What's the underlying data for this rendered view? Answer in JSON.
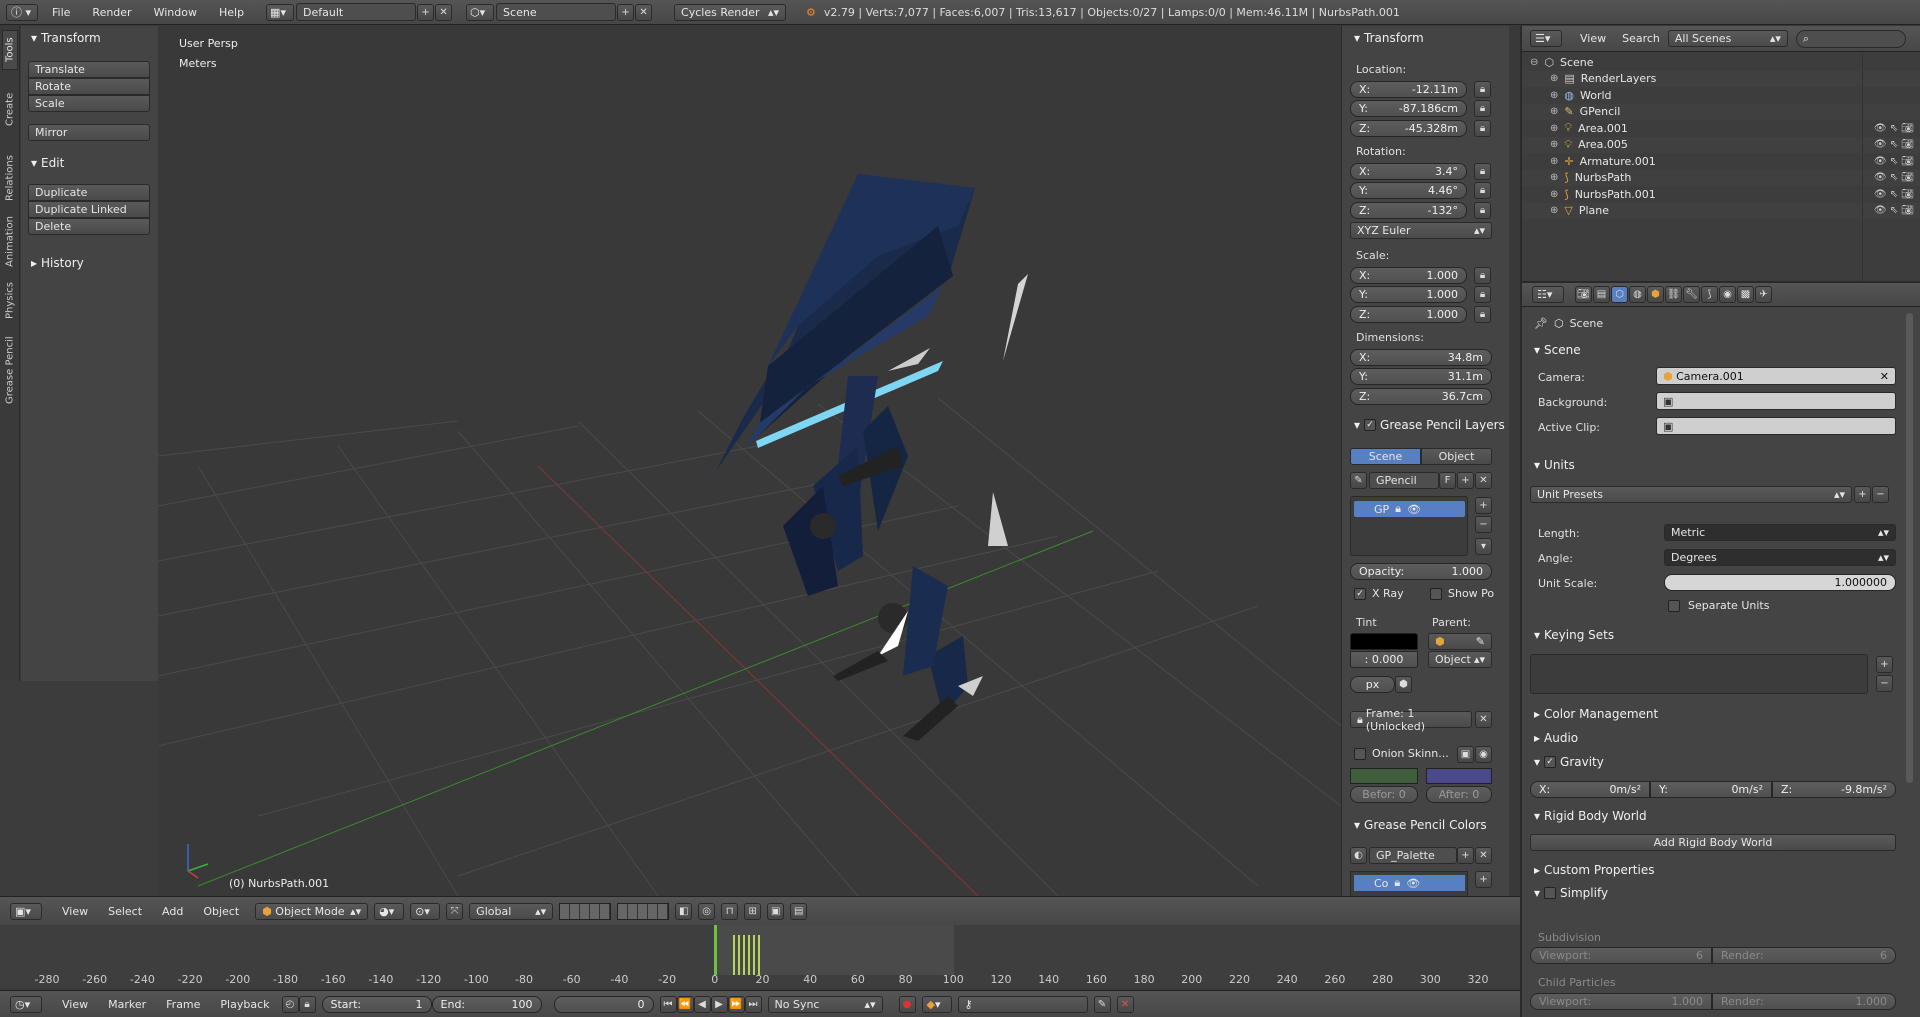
{
  "topbar": {
    "menus": [
      "File",
      "Render",
      "Window",
      "Help"
    ],
    "layout": "Default",
    "scene": "Scene",
    "engine": "Cycles Render",
    "stats": "v2.79 | Verts:7,077 | Faces:6,007 | Tris:13,617 | Objects:0/27 | Lamps:0/0 | Mem:46.11M | NurbsPath.001"
  },
  "tool_tabs": [
    "Tools",
    "Create",
    "Relations",
    "Animation",
    "Physics",
    "Grease Pencil"
  ],
  "tools": {
    "transform_title": "Transform",
    "transform_buttons": [
      "Translate",
      "Rotate",
      "Scale"
    ],
    "mirror": "Mirror",
    "edit_title": "Edit",
    "edit_buttons": [
      "Duplicate",
      "Duplicate Linked",
      "Delete"
    ],
    "history_title": "History"
  },
  "viewport": {
    "view_name": "User Persp",
    "units": "Meters",
    "object_info": "(0) NurbsPath.001"
  },
  "view_header": {
    "menus": [
      "View",
      "Select",
      "Add",
      "Object"
    ],
    "mode": "Object Mode",
    "orientation": "Global"
  },
  "properties_n": {
    "transform_title": "Transform",
    "location_label": "Location:",
    "location": [
      {
        "axis": "X:",
        "value": "-12.11m"
      },
      {
        "axis": "Y:",
        "value": "-87.186cm"
      },
      {
        "axis": "Z:",
        "value": "-45.328m"
      }
    ],
    "rotation_label": "Rotation:",
    "rotation": [
      {
        "axis": "X:",
        "value": "3.4°"
      },
      {
        "axis": "Y:",
        "value": "4.46°"
      },
      {
        "axis": "Z:",
        "value": "-132°"
      }
    ],
    "rotation_mode": "XYZ Euler",
    "scale_label": "Scale:",
    "scale": [
      {
        "axis": "X:",
        "value": "1.000"
      },
      {
        "axis": "Y:",
        "value": "1.000"
      },
      {
        "axis": "Z:",
        "value": "1.000"
      }
    ],
    "dimensions_label": "Dimensions:",
    "dimensions": [
      {
        "axis": "X:",
        "value": "34.8m"
      },
      {
        "axis": "Y:",
        "value": "31.1m"
      },
      {
        "axis": "Z:",
        "value": "36.7cm"
      }
    ],
    "gp_layers_title": "Grease Pencil Layers",
    "gp_scene_tab": "Scene",
    "gp_object_tab": "Object",
    "gp_name": "GPencil",
    "gp_f": "F",
    "gp_layer": "GP",
    "opacity": "Opacity:",
    "opacity_value": "1.000",
    "xray": "X Ray",
    "show_points": "Show Po",
    "tint": "Tint",
    "parent": "Parent:",
    "tint_value": ": 0.000",
    "parent_type": "Object",
    "px": "px",
    "frame": "Frame: 1 (Unlocked)",
    "onion": "Onion Skinn...",
    "before": "Befor: 0",
    "after": "After: 0",
    "gp_colors_title": "Grease Pencil Colors",
    "palette": "GP_Palette",
    "color_item": "Co"
  },
  "outliner": {
    "header_menus": [
      "View",
      "Search"
    ],
    "display": "All Scenes",
    "items": [
      {
        "name": "Scene",
        "indent": 0
      },
      {
        "name": "RenderLayers",
        "indent": 1
      },
      {
        "name": "World",
        "indent": 1
      },
      {
        "name": "GPencil",
        "indent": 1
      },
      {
        "name": "Area.001",
        "indent": 1
      },
      {
        "name": "Area.005",
        "indent": 1
      },
      {
        "name": "Armature.001",
        "indent": 1
      },
      {
        "name": "NurbsPath",
        "indent": 1
      },
      {
        "name": "NurbsPath.001",
        "indent": 1
      },
      {
        "name": "Plane",
        "indent": 1
      }
    ]
  },
  "scene_props": {
    "breadcrumb": "Scene",
    "scene_title": "Scene",
    "camera_label": "Camera:",
    "camera_value": "Camera.001",
    "background_label": "Background:",
    "active_clip_label": "Active Clip:",
    "units_title": "Units",
    "unit_presets": "Unit Presets",
    "length_label": "Length:",
    "length_value": "Metric",
    "angle_label": "Angle:",
    "angle_value": "Degrees",
    "unit_scale_label": "Unit Scale:",
    "unit_scale_value": "1.000000",
    "separate_units": "Separate Units",
    "keying_sets_title": "Keying Sets",
    "color_management": "Color Management",
    "audio": "Audio",
    "gravity": "Gravity",
    "gravity_values": [
      {
        "axis": "X:",
        "value": "0m/s²"
      },
      {
        "axis": "Y:",
        "value": "0m/s²"
      },
      {
        "axis": "Z:",
        "value": "-9.8m/s²"
      }
    ],
    "rigid_body_world": "Rigid Body World",
    "add_rigid_body_world": "Add Rigid Body World",
    "custom_properties": "Custom Properties",
    "simplify": "Simplify",
    "subdivision": "Subdivision",
    "viewport_label": "Viewport:",
    "render_label": "Render:",
    "sub_viewport": "6",
    "sub_render": "6",
    "child_particles": "Child Particles",
    "cp_viewport": "1.000",
    "cp_render": "1.000"
  },
  "timeline": {
    "ticks": [
      "-280",
      "-260",
      "-240",
      "-220",
      "-200",
      "-180",
      "-160",
      "-140",
      "-120",
      "-100",
      "-80",
      "-60",
      "-40",
      "-20",
      "0",
      "20",
      "40",
      "60",
      "80",
      "100",
      "120",
      "140",
      "160",
      "180",
      "200",
      "220",
      "240",
      "260",
      "280",
      "300",
      "320"
    ],
    "menus": [
      "View",
      "Marker",
      "Frame",
      "Playback"
    ],
    "start_label": "Start:",
    "start": "1",
    "end_label": "End:",
    "end": "100",
    "current": "0",
    "sync": "No Sync"
  },
  "colors": {
    "accent": "#5680c2",
    "bg": "#393939",
    "panel": "#424242",
    "header": "#4a4a4a"
  }
}
